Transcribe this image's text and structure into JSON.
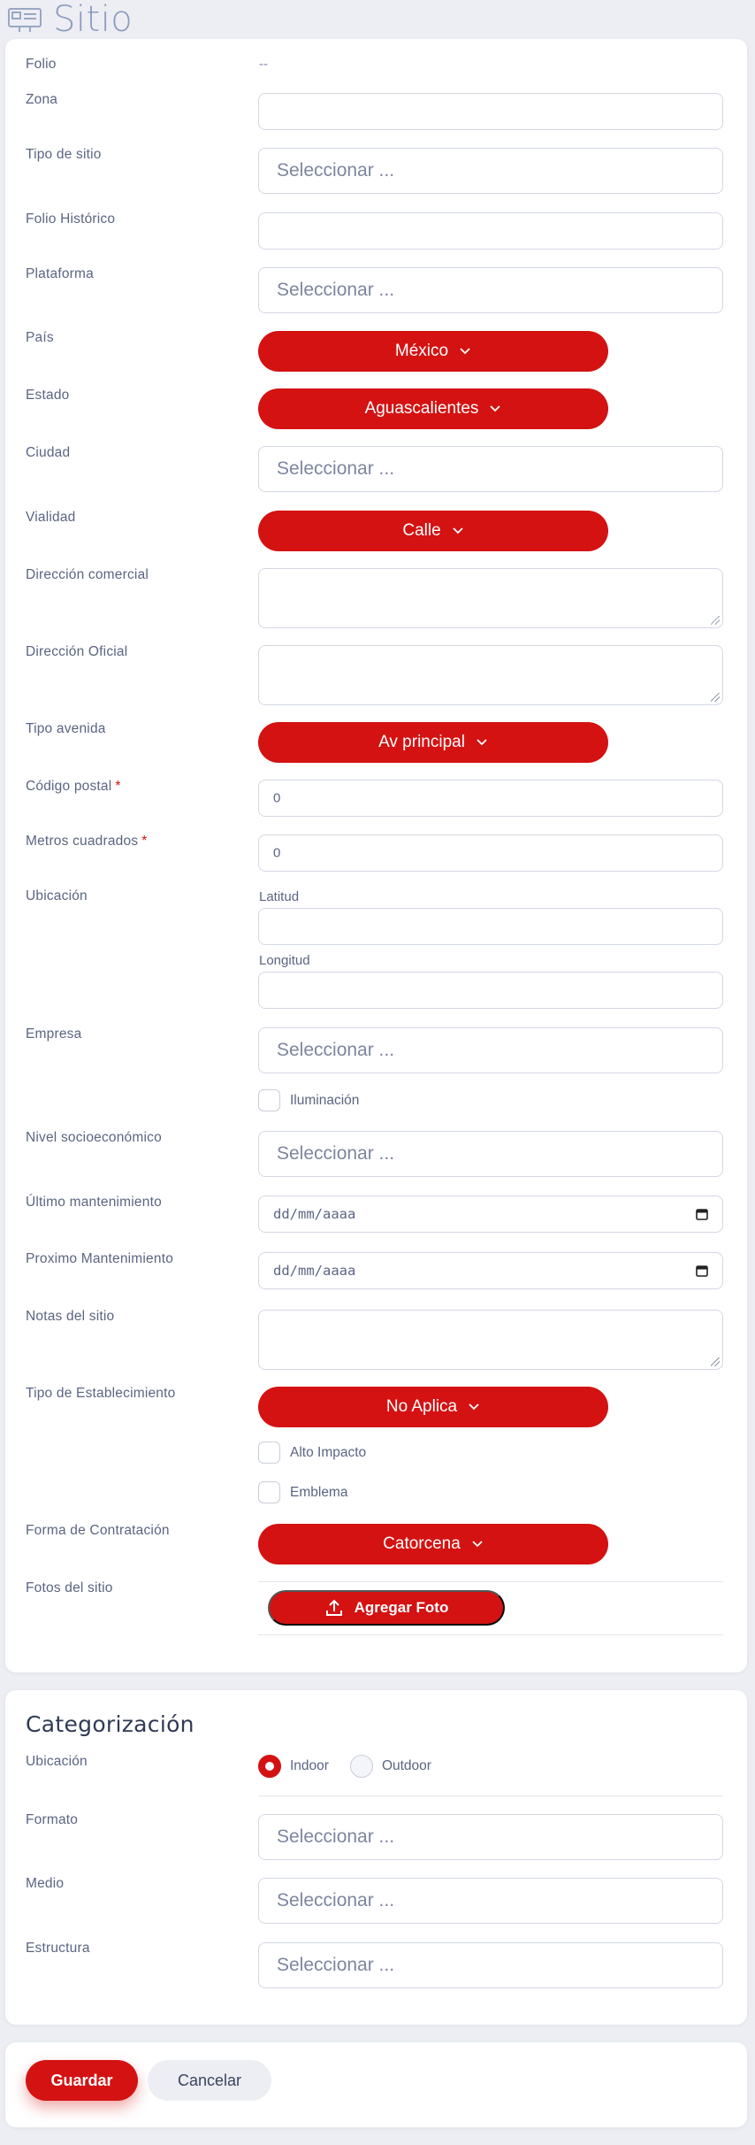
{
  "header": {
    "title": "Sitio",
    "icon": "billboard-icon"
  },
  "form": {
    "folio": {
      "label": "Folio",
      "value": "--"
    },
    "zona": {
      "label": "Zona",
      "value": ""
    },
    "tipo_sitio": {
      "label": "Tipo de sitio",
      "placeholder": "Seleccionar ..."
    },
    "folio_historico": {
      "label": "Folio Histórico",
      "value": ""
    },
    "plataforma": {
      "label": "Plataforma",
      "placeholder": "Seleccionar ..."
    },
    "pais": {
      "label": "País",
      "value": "México"
    },
    "estado": {
      "label": "Estado",
      "value": "Aguascalientes"
    },
    "ciudad": {
      "label": "Ciudad",
      "placeholder": "Seleccionar ..."
    },
    "vialidad": {
      "label": "Vialidad",
      "value": "Calle"
    },
    "direccion_comercial": {
      "label": "Dirección comercial",
      "value": ""
    },
    "direccion_oficial": {
      "label": "Dirección Oficial",
      "value": ""
    },
    "tipo_avenida": {
      "label": "Tipo avenida",
      "value": "Av principal"
    },
    "codigo_postal": {
      "label": "Código postal",
      "required": "*",
      "value": "0"
    },
    "metros_cuadrados": {
      "label": "Metros cuadrados",
      "required": "*",
      "value": "0"
    },
    "ubicacion": {
      "label": "Ubicación",
      "latitud_label": "Latitud",
      "longitud_label": "Longitud"
    },
    "empresa": {
      "label": "Empresa",
      "placeholder": "Seleccionar ..."
    },
    "iluminacion": {
      "label": "Iluminación",
      "checked": false
    },
    "nivel_socioeconomico": {
      "label": "Nivel socioeconómico",
      "placeholder": "Seleccionar ..."
    },
    "ultimo_mantenimiento": {
      "label": "Último mantenimiento",
      "placeholder": "dd/mm/aaaa"
    },
    "proximo_mantenimiento": {
      "label": "Proximo Mantenimiento",
      "placeholder": "dd/mm/aaaa"
    },
    "notas_sitio": {
      "label": "Notas del sitio",
      "value": ""
    },
    "tipo_establecimiento": {
      "label": "Tipo de Establecimiento",
      "value": "No Aplica"
    },
    "alto_impacto": {
      "label": "Alto Impacto",
      "checked": false
    },
    "emblema": {
      "label": "Emblema",
      "checked": false
    },
    "forma_contratacion": {
      "label": "Forma de Contratación",
      "value": "Catorcena"
    },
    "fotos_sitio": {
      "label": "Fotos del sitio",
      "button": "Agregar Foto"
    }
  },
  "categorizacion": {
    "title": "Categorización",
    "ubicacion": {
      "label": "Ubicación",
      "options": [
        "Indoor",
        "Outdoor"
      ],
      "selected": "Indoor"
    },
    "formato": {
      "label": "Formato",
      "placeholder": "Seleccionar ..."
    },
    "medio": {
      "label": "Medio",
      "placeholder": "Seleccionar ..."
    },
    "estructura": {
      "label": "Estructura",
      "placeholder": "Seleccionar ..."
    }
  },
  "actions": {
    "save": "Guardar",
    "cancel": "Cancelar"
  },
  "colors": {
    "accent": "#d41212",
    "background": "#eceef3",
    "label": "#5b6582",
    "title": "#8e9bc0"
  }
}
